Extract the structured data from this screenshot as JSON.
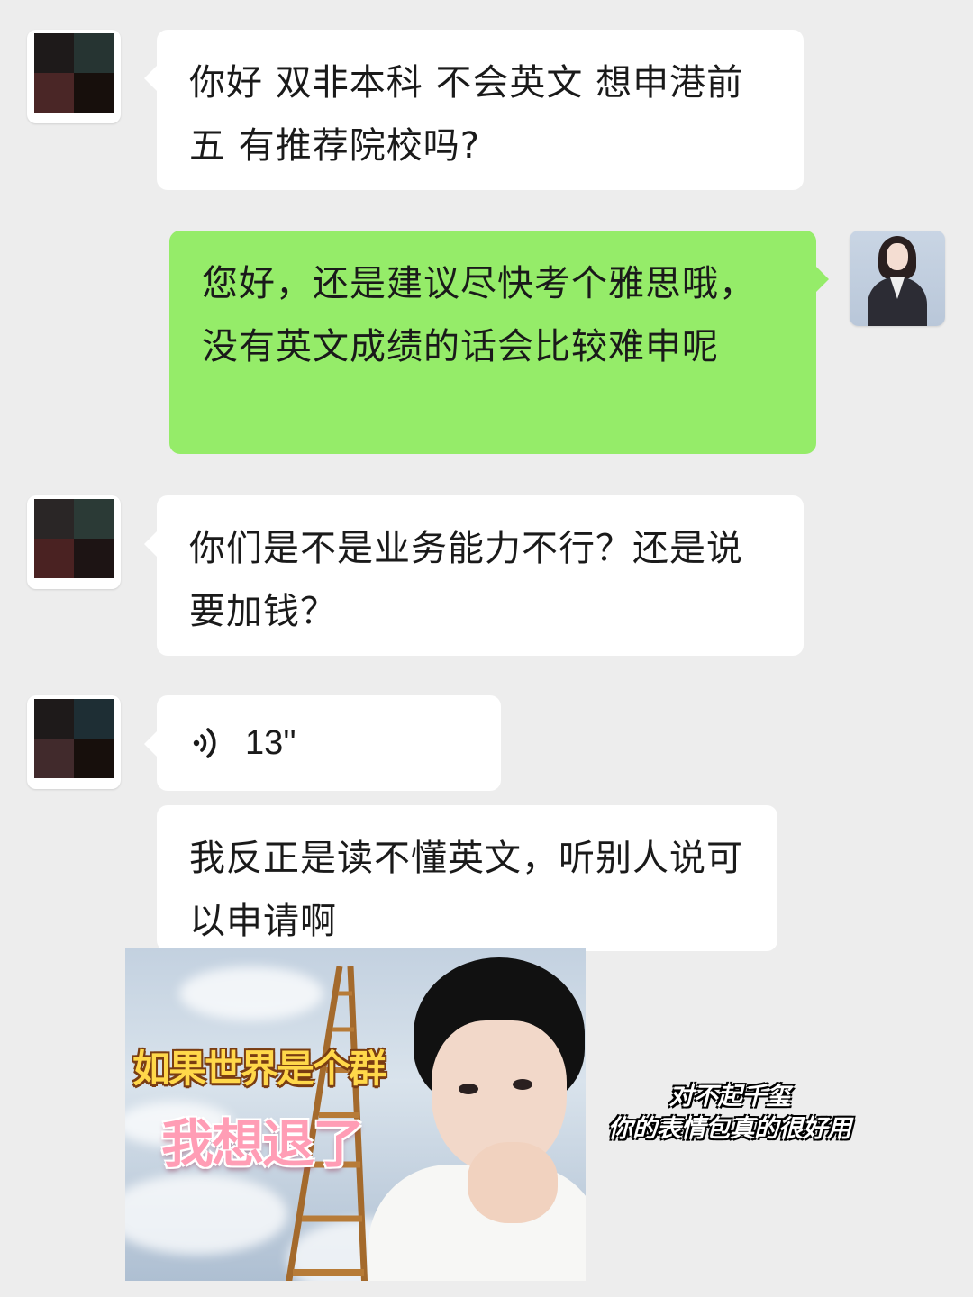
{
  "colors": {
    "chat_background": "#ededed",
    "incoming_bubble": "#ffffff",
    "outgoing_bubble": "#95ec69"
  },
  "messages": [
    {
      "sender": "user",
      "type": "text",
      "text": "你好 双非本科 不会英文 想申港前五 有推荐院校吗?"
    },
    {
      "sender": "advisor",
      "type": "text",
      "text": "您好，还是建议尽快考个雅思哦，没有英文成绩的话会比较难申呢"
    },
    {
      "sender": "user",
      "type": "text",
      "text": "你们是不是业务能力不行？还是说要加钱？"
    },
    {
      "sender": "user",
      "type": "voice",
      "icon": "voice-icon",
      "duration": "13''"
    },
    {
      "sender": "user",
      "type": "text",
      "text": "我反正是读不懂英文，听别人说可以申请啊"
    },
    {
      "sender": "user",
      "type": "sticker",
      "line1": "如果世界是个群",
      "line2": "我想退了"
    }
  ],
  "caption": {
    "line1": "对不起千玺",
    "line2": "你的表情包真的很好用"
  }
}
